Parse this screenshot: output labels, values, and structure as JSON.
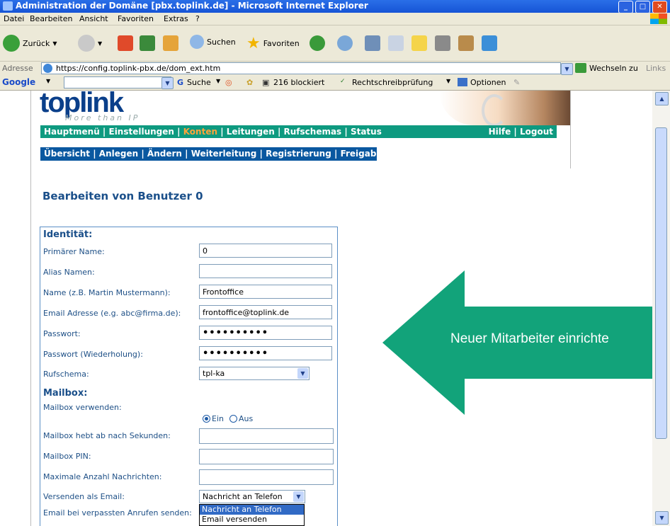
{
  "window": {
    "title": "Administration der Domäne [pbx.toplink.de] - Microsoft Internet Explorer"
  },
  "menubar": {
    "items": [
      "Datei",
      "Bearbeiten",
      "Ansicht",
      "Favoriten",
      "Extras",
      "?"
    ]
  },
  "toolbar": {
    "back": "Zurück",
    "search": "Suchen",
    "favorites": "Favoriten"
  },
  "addressbar": {
    "label": "Adresse",
    "url": "https://config.toplink-pbx.de/dom_ext.htm",
    "go": "Wechseln zu",
    "links": "Links"
  },
  "googlebar": {
    "brand": "Google",
    "search": "Suche",
    "blocked": "216 blockiert",
    "spell": "Rechtschreibprüfung",
    "options": "Optionen"
  },
  "site": {
    "logo": "toplink",
    "logo_sub": "More than IP",
    "nav_main": [
      "Hauptmenü",
      "Einstellungen",
      "Konten",
      "Leitungen",
      "Rufschemas",
      "Status"
    ],
    "nav_main_active": "Konten",
    "nav_right": [
      "Hilfe",
      "Logout"
    ],
    "nav_sub": [
      "Übersicht",
      "Anlegen",
      "Ändern",
      "Weiterleitung",
      "Registrierung",
      "Freigaben"
    ]
  },
  "page_title": "Bearbeiten von Benutzer 0",
  "identity": {
    "heading": "Identität:",
    "primary_name_label": "Primärer Name:",
    "primary_name": "0",
    "alias_label": "Alias Namen:",
    "alias": "",
    "name_label": "Name (z.B. Martin Mustermann):",
    "name": "Frontoffice",
    "email_label": "Email Adresse (e.g. abc@firma.de):",
    "email": "frontoffice@toplink.de",
    "password_label": "Passwort:",
    "password": "••••••••••",
    "password_repeat_label": "Passwort (Wiederholung):",
    "password_repeat": "••••••••••",
    "ring_scheme_label": "Rufschema:",
    "ring_scheme": "tpl-ka"
  },
  "mailbox": {
    "heading": "Mailbox:",
    "use_label": "Mailbox verwenden:",
    "use_on": "Ein",
    "use_off": "Aus",
    "use_selected": "Ein",
    "pickup_label": "Mailbox hebt ab nach Sekunden:",
    "pickup": "",
    "pin_label": "Mailbox PIN:",
    "pin": "",
    "max_label": "Maximale Anzahl Nachrichten:",
    "max": "",
    "send_email_label": "Versenden als Email:",
    "send_email": "Nachricht an Telefon",
    "send_email_options": [
      "Nachricht an Telefon",
      "Email versenden"
    ],
    "missed_label": "Email bei verpassten Anrufen senden:"
  },
  "callout": {
    "text": "Neuer Mitarbeiter einrichte",
    "color": "#12a37a"
  },
  "colors": {
    "nav_main": "#0e9a80",
    "nav_sub": "#0a58a0",
    "active": "#ffa43a",
    "heading": "#1a4f8a"
  }
}
